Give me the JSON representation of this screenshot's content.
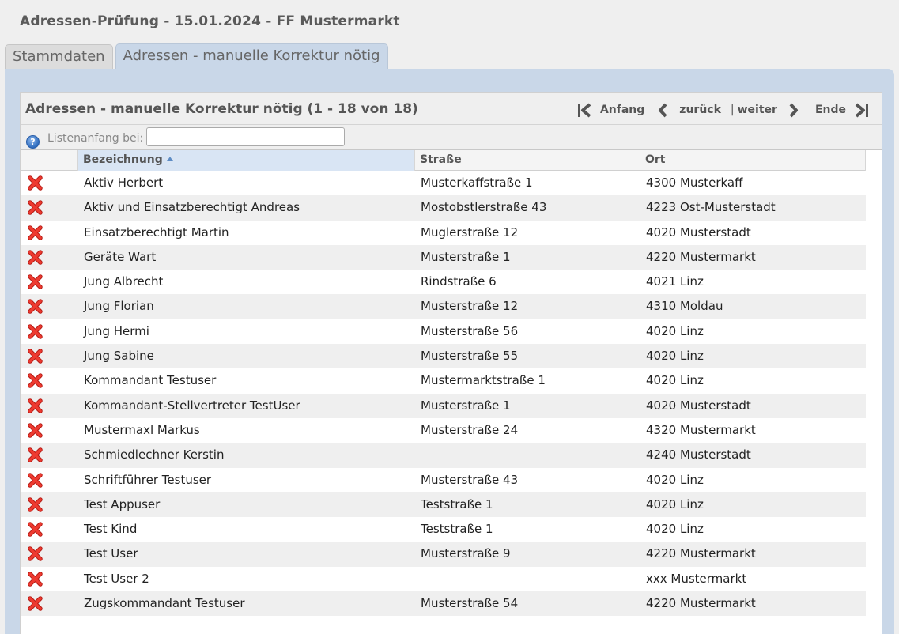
{
  "page": {
    "title": "Adressen-Prüfung - 15.01.2024 - FF Mustermarkt"
  },
  "tabs": [
    {
      "label": "Stammdaten",
      "active": false
    },
    {
      "label": "Adressen - manuelle Korrektur nötig",
      "active": true
    }
  ],
  "list": {
    "title": "Adressen - manuelle Korrektur nötig (1 - 18 von 18)",
    "pager": {
      "first_label": "Anfang",
      "prev_label": "zurück",
      "separator": "|",
      "next_label": "weiter",
      "last_label": "Ende"
    },
    "filter": {
      "help_icon": "help-icon",
      "label": "Listenanfang bei:",
      "value": ""
    },
    "columns": {
      "name": "Bezeichnung",
      "street": "Straße",
      "city": "Ort",
      "sort_column": "Bezeichnung",
      "sort_direction": "ascending"
    },
    "delete_icon": "delete-x-icon",
    "rows": [
      {
        "name": "Aktiv Herbert",
        "street": "Musterkaffstraße 1",
        "city": "4300 Musterkaff"
      },
      {
        "name": "Aktiv und Einsatzberechtigt Andreas",
        "street": "Mostobstlerstraße 43",
        "city": "4223 Ost-Musterstadt"
      },
      {
        "name": "Einsatzberechtigt Martin",
        "street": "Muglerstraße 12",
        "city": "4020 Musterstadt"
      },
      {
        "name": "Geräte Wart",
        "street": "Musterstraße 1",
        "city": "4220 Mustermarkt"
      },
      {
        "name": "Jung Albrecht",
        "street": "Rindstraße 6",
        "city": "4021 Linz"
      },
      {
        "name": "Jung Florian",
        "street": "Musterstraße 12",
        "city": "4310 Moldau"
      },
      {
        "name": "Jung Hermi",
        "street": "Musterstraße 56",
        "city": "4020 Linz"
      },
      {
        "name": "Jung Sabine",
        "street": "Musterstraße 55",
        "city": "4020 Linz"
      },
      {
        "name": "Kommandant Testuser",
        "street": "Mustermarktstraße 1",
        "city": "4020 Linz"
      },
      {
        "name": "Kommandant-Stellvertreter TestUser",
        "street": "Musterstraße 1",
        "city": "4020 Musterstadt"
      },
      {
        "name": "Mustermaxl Markus",
        "street": "Musterstraße 24",
        "city": "4320 Mustermarkt"
      },
      {
        "name": "Schmiedlechner Kerstin",
        "street": "",
        "city": "4240 Musterstadt"
      },
      {
        "name": "Schriftführer Testuser",
        "street": "Musterstraße 43",
        "city": "4020 Linz"
      },
      {
        "name": "Test Appuser",
        "street": "Teststraße 1",
        "city": "4020 Linz"
      },
      {
        "name": "Test Kind",
        "street": "Teststraße 1",
        "city": "4020 Linz"
      },
      {
        "name": "Test User",
        "street": "Musterstraße 9",
        "city": "4220 Mustermarkt"
      },
      {
        "name": "Test User 2",
        "street": "",
        "city": "xxx Mustermarkt"
      },
      {
        "name": "Zugskommandant Testuser",
        "street": "Musterstraße 54",
        "city": "4220 Mustermarkt"
      }
    ]
  },
  "colors": {
    "panel": "#c9d7e8",
    "delete": "#e8312a",
    "sorted_header": "#d9e5f4"
  }
}
